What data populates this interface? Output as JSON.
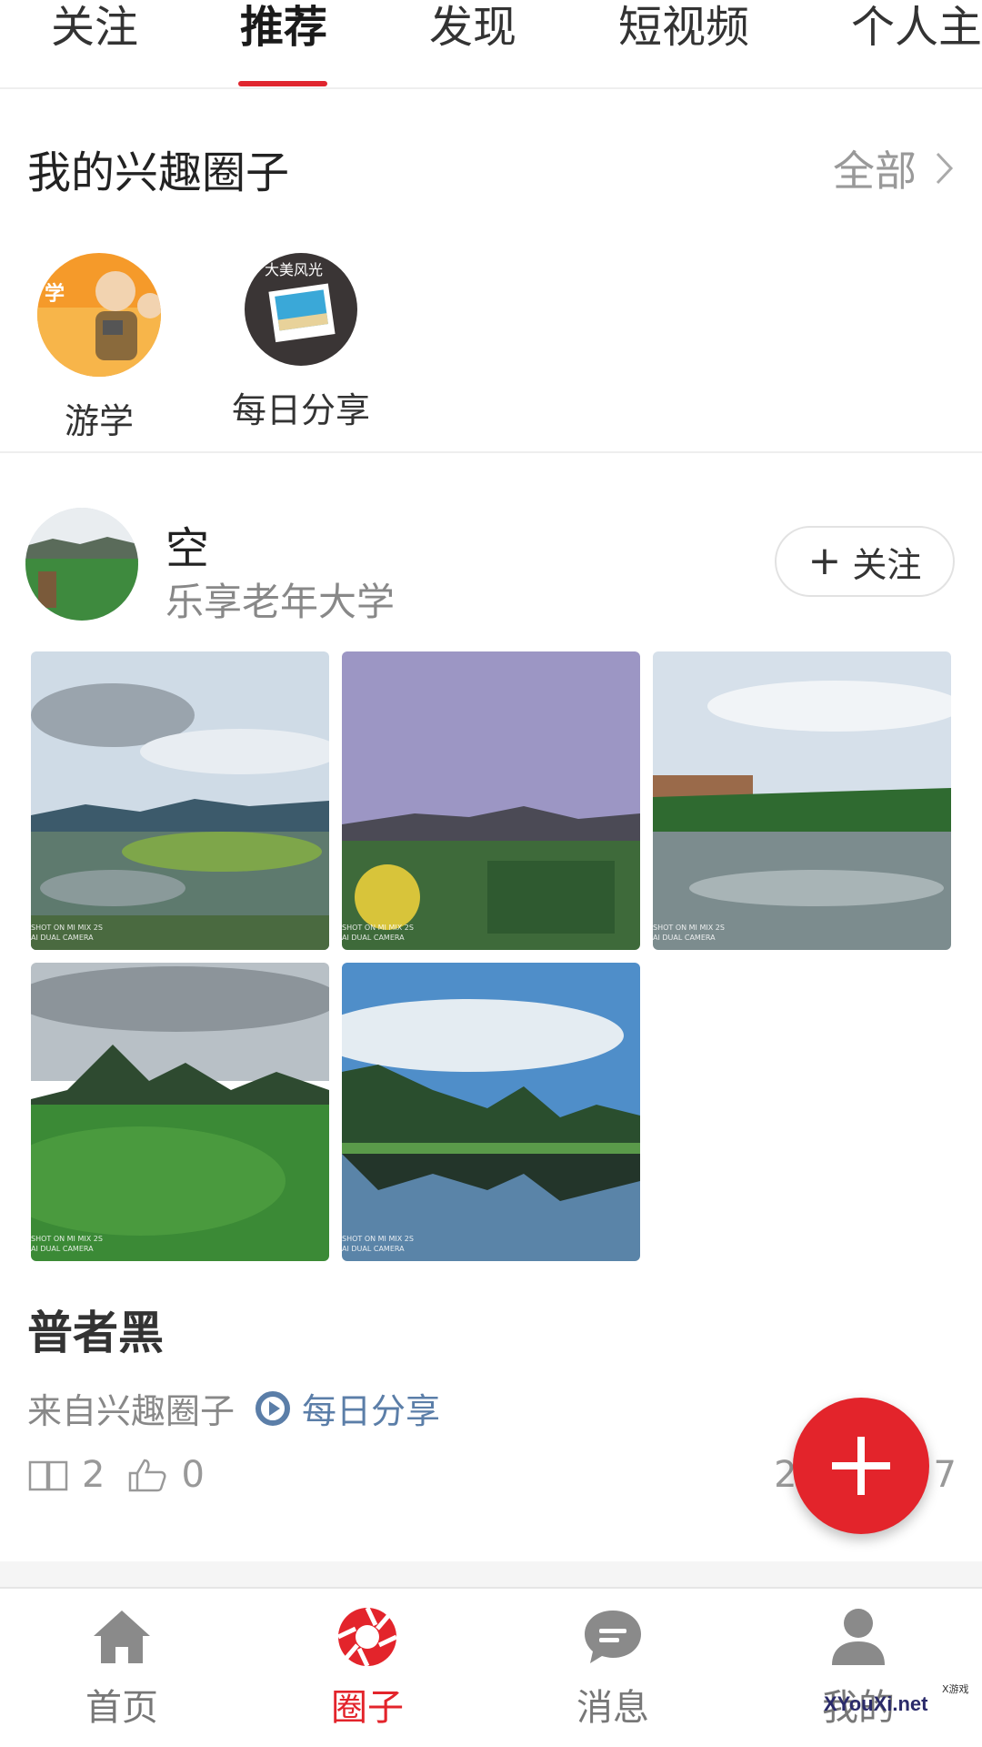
{
  "top_tabs": [
    {
      "label": "关注",
      "active": false
    },
    {
      "label": "推荐",
      "active": true
    },
    {
      "label": "发现",
      "active": false
    },
    {
      "label": "短视频",
      "active": false
    },
    {
      "label": "个人主",
      "active": false
    }
  ],
  "interest": {
    "title": "我的兴趣圈子",
    "all_label": "全部",
    "circles": [
      {
        "label": "游学",
        "icon": "travel-study-avatar"
      },
      {
        "label": "每日分享",
        "icon": "daily-share-avatar",
        "badge_text": "大美风光"
      }
    ]
  },
  "post": {
    "user_name": "空",
    "source": "乐享老年大学",
    "follow_label": "关注",
    "photo_watermark": [
      "SHOT ON MI MIX 2S",
      "AI DUAL CAMERA"
    ],
    "title": "普者黑",
    "from_label": "来自兴趣圈子",
    "from_circle": "每日分享",
    "read_count": "2",
    "like_count": "0",
    "date_partial": "2",
    "date_end": "7"
  },
  "bottom_nav": [
    {
      "label": "首页",
      "icon": "home-icon",
      "active": false
    },
    {
      "label": "圈子",
      "icon": "aperture-icon",
      "active": true
    },
    {
      "label": "消息",
      "icon": "message-icon",
      "active": false
    },
    {
      "label": "我的",
      "icon": "profile-icon",
      "active": false
    }
  ],
  "colors": {
    "accent": "#e3242b",
    "link": "#5b7ea8"
  },
  "watermark": {
    "site": "XYouXi.net",
    "small": "X游戏"
  }
}
